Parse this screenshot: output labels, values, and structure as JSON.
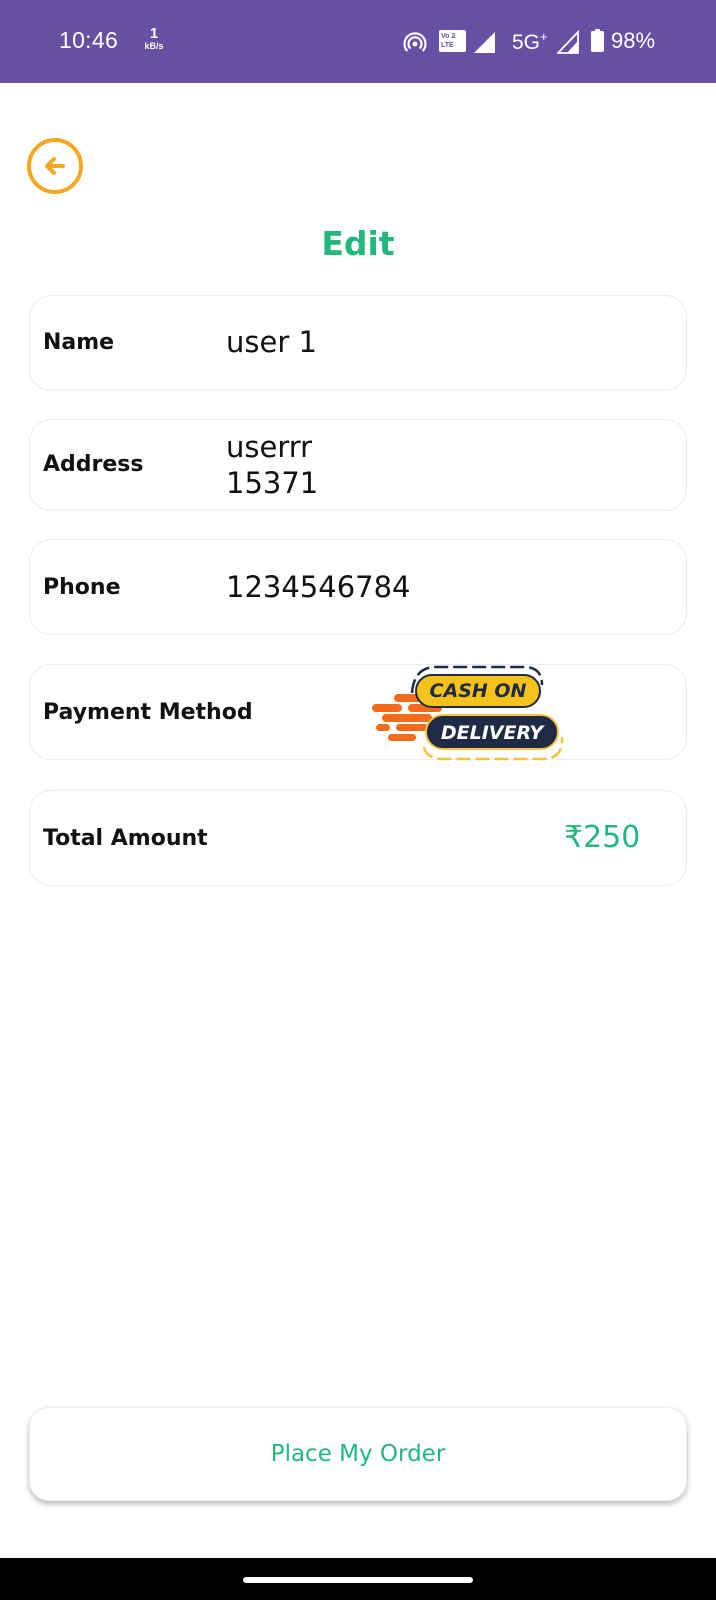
{
  "status_bar": {
    "time": "10:46",
    "net_speed_value": "1",
    "net_speed_unit": "kB/s",
    "volte_line1": "Vo",
    "volte_line2": "LTE",
    "volte_sim": "2",
    "network": "5G",
    "network_plus": "+",
    "battery": "98%"
  },
  "header": {
    "back_icon": "arrow-left-circle-icon",
    "title": "Edit"
  },
  "form": {
    "name": {
      "label": "Name",
      "value": "user 1"
    },
    "address": {
      "label": "Address",
      "value_line1": "userrr",
      "value_line2": "15371"
    },
    "phone": {
      "label": "Phone",
      "value": "1234546784"
    },
    "payment": {
      "label": "Payment Method",
      "logo_line1": "CASH ON",
      "logo_line2": "DELIVERY"
    },
    "total": {
      "label": "Total Amount",
      "value": "₹250"
    }
  },
  "actions": {
    "place_order_label": "Place My Order"
  },
  "colors": {
    "status_bar": "#6650a4",
    "accent_green": "#21b77e",
    "back_orange": "#f5a623"
  }
}
